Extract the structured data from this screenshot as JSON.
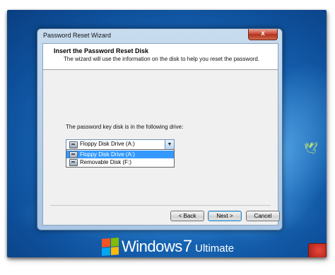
{
  "desktop": {
    "brand_name": "Windows",
    "brand_version": "7",
    "brand_edition": "Ultimate"
  },
  "dialog": {
    "title": "Password Reset Wizard",
    "close_label": "x",
    "heading": "Insert the Password Reset Disk",
    "subheading": "The wizard will use the information on the disk to help you reset the password.",
    "prompt": "The password key disk is in the following drive:",
    "combo": {
      "selected": "Floppy Disk Drive (A:)",
      "options": [
        {
          "label": "Floppy Disk Drive (A:)",
          "icon": "floppy-drive-icon",
          "highlighted": true
        },
        {
          "label": "Removable Disk (F:)",
          "icon": "removable-disk-icon",
          "highlighted": false
        }
      ]
    },
    "buttons": {
      "back": "< Back",
      "next": "Next >",
      "cancel": "Cancel"
    }
  },
  "colors": {
    "selection": "#3399ff",
    "desktop_blue": "#1a6cbd",
    "close_red": "#c7412d"
  }
}
